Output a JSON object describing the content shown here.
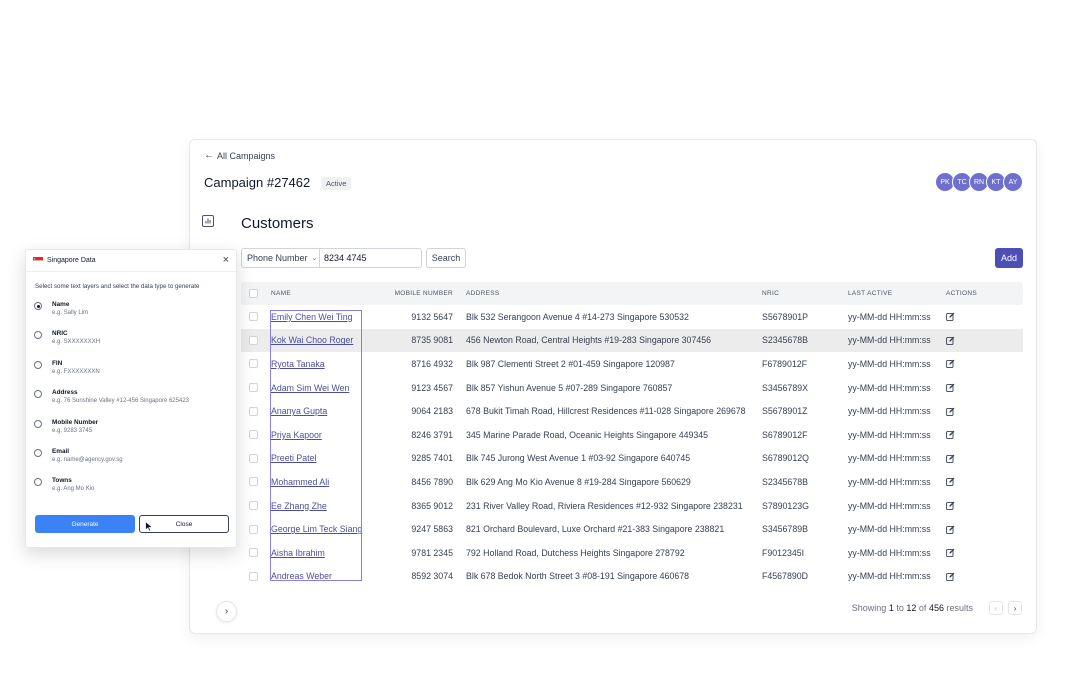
{
  "campaign": {
    "back_label": "All Campaigns",
    "title": "Campaign #27462",
    "status": "Active",
    "avatars": [
      "PK",
      "TC",
      "RN",
      "KT",
      "AY"
    ],
    "section_title": "Customers"
  },
  "filter": {
    "field": "Phone Number",
    "value": "8234 4745",
    "search_label": "Search",
    "add_label": "Add"
  },
  "table": {
    "headers": {
      "name": "NAME",
      "mobile": "MOBILE NUMBER",
      "address": "ADDRESS",
      "nric": "NRIC",
      "last_active": "LAST ACTIVE",
      "actions": "ACTIONS"
    },
    "rows": [
      {
        "name": "Emily Chen Wei Ting",
        "mobile": "9132 5647",
        "address": "Blk 532 Serangoon Avenue 4 #14-273 Singapore 530532",
        "nric": "S5678901P",
        "last_active": "yy-MM-dd HH:mm:ss"
      },
      {
        "name": "Kok Wai Choo Roger",
        "mobile": "8735 9081",
        "address": "456 Newton Road, Central Heights #19-283 Singapore 307456",
        "nric": "S2345678B",
        "last_active": "yy-MM-dd HH:mm:ss"
      },
      {
        "name": "Ryota Tanaka",
        "mobile": "8716 4932",
        "address": "Blk 987 Clementi Street 2 #01-459 Singapore 120987",
        "nric": "F6789012F",
        "last_active": "yy-MM-dd HH:mm:ss"
      },
      {
        "name": "Adam Sim Wei Wen",
        "mobile": "9123 4567",
        "address": "Blk 857 Yishun Avenue 5 #07-289 Singapore 760857",
        "nric": "S3456789X",
        "last_active": "yy-MM-dd HH:mm:ss"
      },
      {
        "name": "Ananya Gupta",
        "mobile": "9064 2183",
        "address": "678 Bukit Timah Road, Hillcrest Residences #11-028 Singapore 269678",
        "nric": "S5678901Z",
        "last_active": "yy-MM-dd HH:mm:ss"
      },
      {
        "name": "Priya Kapoor",
        "mobile": "8246 3791",
        "address": "345 Marine Parade Road, Oceanic Heights Singapore 449345",
        "nric": "S6789012F",
        "last_active": "yy-MM-dd HH:mm:ss"
      },
      {
        "name": "Preeti Patel",
        "mobile": "9285 7401",
        "address": "Blk 745 Jurong West Avenue 1 #03-92 Singapore 640745",
        "nric": "S6789012Q",
        "last_active": "yy-MM-dd HH:mm:ss"
      },
      {
        "name": "Mohammed Ali",
        "mobile": "8456 7890",
        "address": "Blk 629 Ang Mo Kio Avenue 8 #19-284 Singapore 560629",
        "nric": "S2345678B",
        "last_active": "yy-MM-dd HH:mm:ss"
      },
      {
        "name": "Ee Zhang Zhe",
        "mobile": "8365 9012",
        "address": "231 River Valley Road, Riviera Residences #12-932 Singapore 238231",
        "nric": "S7890123G",
        "last_active": "yy-MM-dd HH:mm:ss"
      },
      {
        "name": "George Lim Teck Siang",
        "mobile": "9247 5863",
        "address": "821 Orchard Boulevard, Luxe Orchard #21-383 Singapore 238821",
        "nric": "S3456789B",
        "last_active": "yy-MM-dd HH:mm:ss"
      },
      {
        "name": "Aisha Ibrahim",
        "mobile": "9781 2345",
        "address": "792 Holland Road, Dutchess Heights Singapore 278792",
        "nric": "F9012345I",
        "last_active": "yy-MM-dd HH:mm:ss"
      },
      {
        "name": "Andreas Weber",
        "mobile": "8592 3074",
        "address": "Blk 678 Bedok North Street 3 #08-191 Singapore 460678",
        "nric": "F4567890D",
        "last_active": "yy-MM-dd HH:mm:ss"
      }
    ],
    "highlighted_row": 1
  },
  "pagination": {
    "prefix": "Showing",
    "from": "1",
    "to_word": "to",
    "to": "12",
    "of_word": "of",
    "total": "456",
    "suffix": "results"
  },
  "dialog": {
    "title": "Singapore Data",
    "instruction": "Select some text layers and select the data type to generate",
    "options": [
      {
        "label": "Name",
        "example": "e.g. Sally Lim"
      },
      {
        "label": "NRIC",
        "example": "e.g. SXXXXXXXH"
      },
      {
        "label": "FIN",
        "example": "e.g. FXXXXXXXN"
      },
      {
        "label": "Address",
        "example": "e.g. 76 Sunshine Valley #12-456 Singapore 625423"
      },
      {
        "label": "Mobile Number",
        "example": "e.g. 9283 3745"
      },
      {
        "label": "Email",
        "example": "e.g. name@agency.gov.sg"
      },
      {
        "label": "Towns",
        "example": "e.g. Ang Mo Kio"
      }
    ],
    "selected_option": 0,
    "generate_label": "Generate",
    "close_label": "Close"
  },
  "colors": {
    "accent": "#4c4fb5",
    "avatar": "#6f6fd0",
    "generate": "#3b82f6",
    "selection": "#8b7ee0"
  }
}
